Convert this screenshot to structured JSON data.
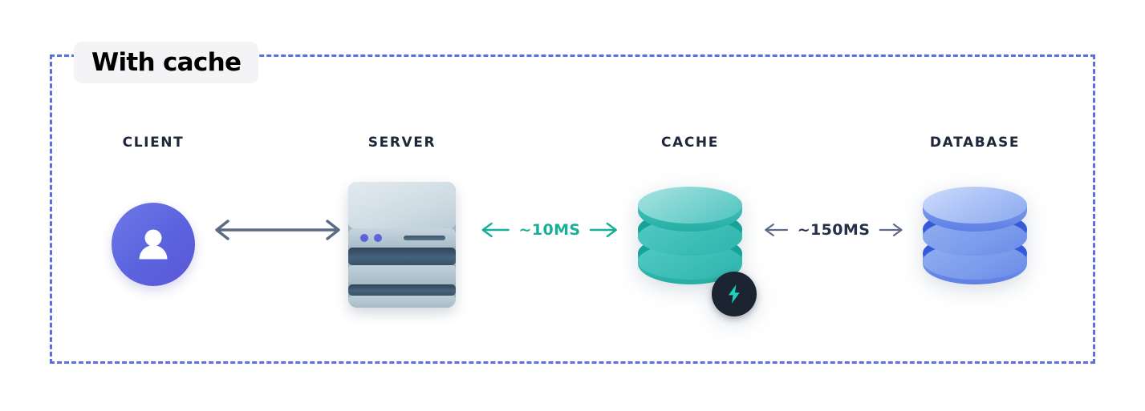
{
  "diagram": {
    "title": "With cache",
    "border_color": "#5b6fe3",
    "title_badge_bg": "#f4f4f7",
    "nodes": [
      {
        "id": "client",
        "label": "CLIENT",
        "icon": "user-avatar-icon",
        "color": "#5a63dd"
      },
      {
        "id": "server",
        "label": "SERVER",
        "icon": "server-rack-icon",
        "color": "#46637b"
      },
      {
        "id": "cache",
        "label": "CACHE",
        "icon": "database-cylinder-icon",
        "color": "#2eb6ad",
        "badge_icon": "lightning-bolt-icon",
        "badge_bg": "#1b2430",
        "badge_fg": "#19d3bd"
      },
      {
        "id": "database",
        "label": "DATABASE",
        "icon": "database-cylinder-icon",
        "color": "#6a8ae8"
      }
    ],
    "connections": [
      {
        "id": "client-server",
        "from": "client",
        "to": "server",
        "label": "",
        "color": "#5b6b85",
        "bidirectional": true
      },
      {
        "id": "server-cache",
        "from": "server",
        "to": "cache",
        "label": "~10MS",
        "color": "#16b098",
        "bidirectional": true
      },
      {
        "id": "cache-database",
        "from": "cache",
        "to": "database",
        "label": "~150MS",
        "color": "#27304a",
        "bidirectional": true
      }
    ]
  }
}
